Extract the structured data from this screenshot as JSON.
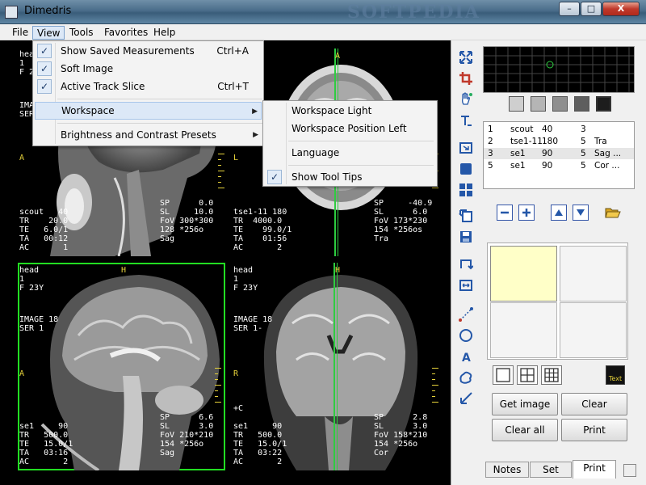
{
  "window": {
    "title": "Dimedris",
    "watermark": "SOFTPEDIA",
    "buttons": {
      "minimize": "–",
      "maximize": "□",
      "close": "X"
    }
  },
  "menubar": {
    "items": [
      "File",
      "View",
      "Tools",
      "Favorites",
      "Help"
    ]
  },
  "view_menu": {
    "items": [
      {
        "label": "Show Saved Measurements",
        "shortcut": "Ctrl+A",
        "checked": true
      },
      {
        "label": "Soft Image",
        "shortcut": "",
        "checked": true
      },
      {
        "label": "Active Track Slice",
        "shortcut": "Ctrl+T",
        "checked": true
      },
      {
        "label": "Workspace",
        "shortcut": "",
        "submenu": true,
        "highlighted": true
      },
      {
        "label": "Brightness and Contrast Presets",
        "shortcut": "",
        "submenu": true
      }
    ]
  },
  "workspace_submenu": {
    "items": [
      {
        "label": "Workspace Light",
        "checked": false
      },
      {
        "label": "Workspace Position Left",
        "checked": false
      },
      {
        "label": "Language",
        "checked": false
      },
      {
        "label": "Show Tool Tips",
        "checked": true
      }
    ]
  },
  "panes": {
    "top_left": {
      "tl": "head\n1\nF 2",
      "mid": "IMAGE\nSER",
      "marker": "A",
      "bl": "scout   40\nTR    20.0\nTE   6.0/1\nTA   00:12\nAC       1",
      "br": "SP      0.0\nSL     10.0\nFoV 300*300\n128 *256o\nSag"
    },
    "top_right": {
      "marker_top": "A",
      "marker_left": "L",
      "bl": "tse1-11 180\nTR  4000.0\nTE    99.0/1\nTA    01:56\nAC       2",
      "br": "SP     -40.9\nSL      6.0\nFoV 173*230\n154 *256os\nTra"
    },
    "bottom_left": {
      "tl": "head\n1\nF 23Y",
      "marker_top": "H",
      "mid": "IMAGE 18\nSER 1",
      "marker": "A",
      "bl": "se1     90\nTR   500.0\nTE   15.0/1\nTA   03:16\nAC       2",
      "br": "SP      6.6\nSL      3.0\nFoV 210*210\n154 *256o\nSag"
    },
    "bottom_right": {
      "tl": "head\n1\nF 23Y",
      "marker_top": "H",
      "mid": "IMAGE 18\nSER 1-",
      "marker": "R",
      "plus": "+C",
      "bl": "se1     90\nTR   500.0\nTE   15.0/1\nTA   03:22\nAC       2",
      "br": "SP      2.8\nSL      3.0\nFoV 158*210\n154 *256o\nCor"
    }
  },
  "series_list": {
    "rows": [
      {
        "c1": "1",
        "c2": "scout",
        "c3": "40",
        "c4": "3",
        "c5": ""
      },
      {
        "c1": "2",
        "c2": "tse1-11",
        "c3": "180",
        "c4": "5",
        "c5": "Tra"
      },
      {
        "c1": "3",
        "c2": "se1",
        "c3": "90",
        "c4": "5",
        "c5": "Sag  ..."
      },
      {
        "c1": "5",
        "c2": "se1",
        "c3": "90",
        "c4": "5",
        "c5": "Cor  ..."
      }
    ]
  },
  "buttons": {
    "get_image": "Get image",
    "clear": "Clear",
    "clear_all": "Clear all",
    "print": "Print"
  },
  "tabs": [
    "Notes",
    "Set",
    "Print"
  ],
  "text_tool_label": "Text",
  "colors": {
    "selection": "#22dd22",
    "overlay_yellow": "#e6d23a",
    "active_cell": "#ffffc8",
    "tool_blue": "#2457a8"
  }
}
